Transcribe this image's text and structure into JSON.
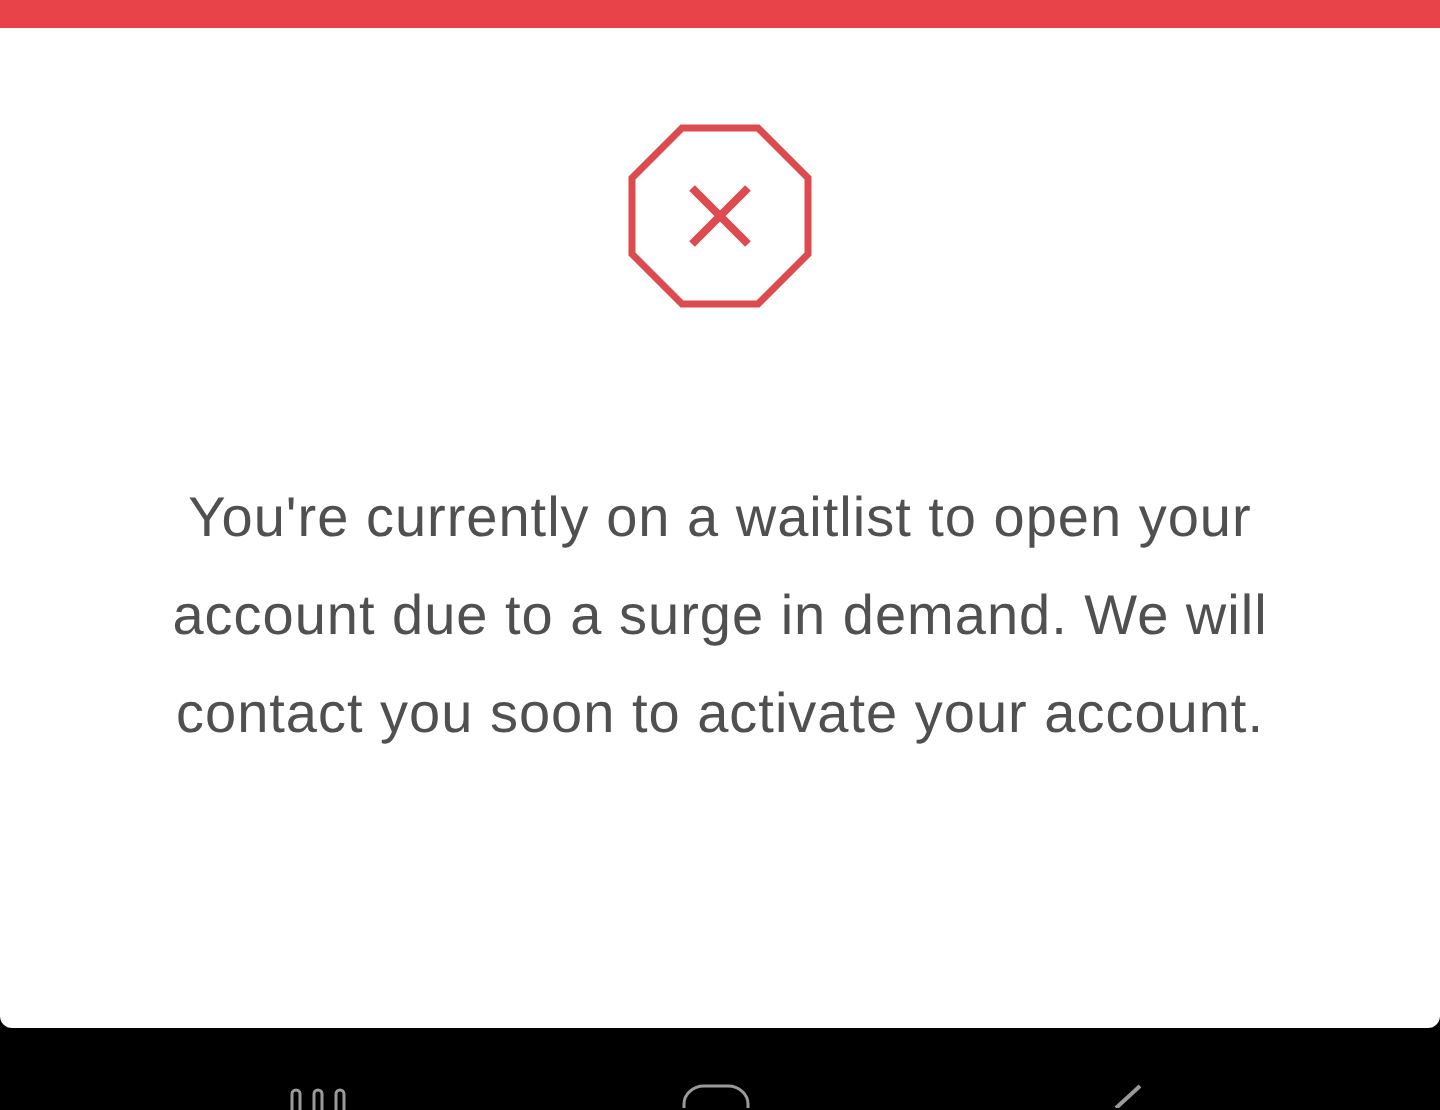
{
  "dialog": {
    "message": "You're currently on a waitlist to open your account due to a surge in demand. We will contact you soon to activate your account."
  }
}
